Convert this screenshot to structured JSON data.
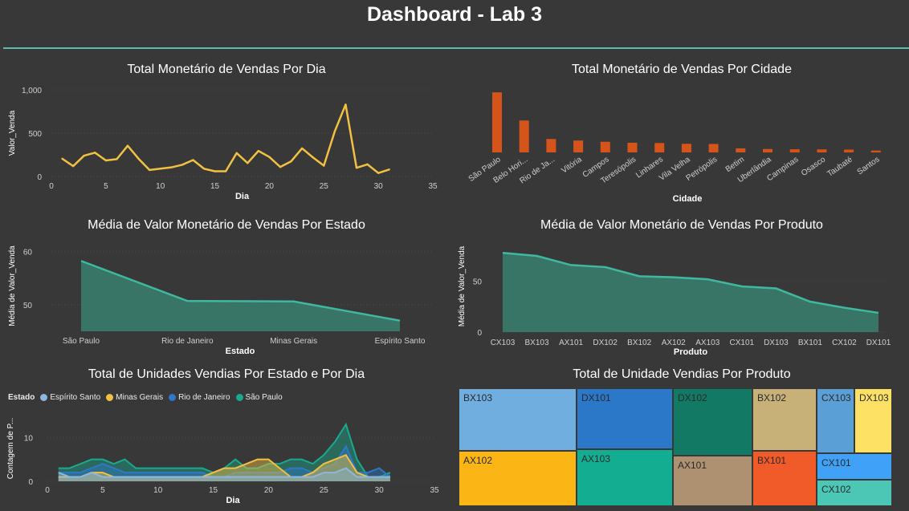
{
  "dashboard": {
    "title": "Dashboard - Lab 3"
  },
  "chart_data": [
    {
      "id": "daily",
      "type": "line",
      "title": "Total Monetário de Vendas Por Dia",
      "xlabel": "Dia",
      "ylabel": "Valor_Venda",
      "xlim": [
        0,
        35
      ],
      "ylim": [
        0,
        1000
      ],
      "xticks": [
        "0",
        "5",
        "10",
        "15",
        "20",
        "25",
        "30",
        "35"
      ],
      "yticks": [
        "0",
        "500",
        "1,000"
      ],
      "color": "#f2c043",
      "x": [
        1,
        2,
        3,
        4,
        5,
        6,
        7,
        8,
        9,
        10,
        11,
        12,
        13,
        14,
        15,
        16,
        17,
        18,
        19,
        20,
        21,
        22,
        23,
        24,
        25,
        26,
        27,
        28,
        29,
        30,
        31
      ],
      "values": [
        205,
        120,
        240,
        275,
        185,
        200,
        355,
        205,
        75,
        90,
        105,
        135,
        190,
        90,
        60,
        60,
        270,
        155,
        295,
        225,
        110,
        175,
        325,
        220,
        125,
        520,
        830,
        100,
        140,
        40,
        80
      ]
    },
    {
      "id": "city",
      "type": "bar",
      "title": "Total Monetário de Vendas Por Cidade",
      "xlabel": "Cidade",
      "ylabel": "",
      "color": "#d5541a",
      "categories": [
        "São Paulo",
        "Belo Hori...",
        "Rio de Ja...",
        "Vitória",
        "Campos",
        "Teresópolis",
        "Linhares",
        "Vila Velha",
        "Petrópolis",
        "Betim",
        "Uberlândia",
        "Campinas",
        "Osasco",
        "Taubaté",
        "Santos"
      ],
      "values": [
        960,
        510,
        215,
        190,
        170,
        155,
        150,
        138,
        135,
        65,
        55,
        50,
        48,
        45,
        30
      ],
      "ylim": [
        0,
        1000
      ]
    },
    {
      "id": "state_avg",
      "type": "area",
      "title": "Média de Valor Monetário de Vendas Por Estado",
      "xlabel": "Estado",
      "ylabel": "Média de Valor_Venda",
      "ylim": [
        45,
        62
      ],
      "yticks": [
        "50",
        "60"
      ],
      "color": "#40b8a0",
      "fill": "#387566",
      "categories": [
        "São Paulo",
        "Rio de Janeiro",
        "Minas Gerais",
        "Espírito Santo"
      ],
      "values": [
        58.2,
        50.7,
        50.6,
        47.0
      ]
    },
    {
      "id": "product_avg",
      "type": "area",
      "title": "Média de Valor Monetário de Vendas Por Produto",
      "xlabel": "Produto",
      "ylabel": "Média de Valor_Venda",
      "ylim": [
        0,
        90
      ],
      "yticks": [
        "0",
        "50"
      ],
      "color": "#40b8a0",
      "fill": "#387566",
      "categories": [
        "CX103",
        "BX103",
        "AX101",
        "DX102",
        "BX102",
        "AX102",
        "AX103",
        "CX101",
        "DX103",
        "BX101",
        "CX102",
        "DX101"
      ],
      "values": [
        78,
        75,
        66,
        64,
        55,
        54,
        52,
        45,
        43,
        30,
        24,
        19
      ]
    },
    {
      "id": "units_state_day",
      "type": "area",
      "title": "Total de Unidades Vendias Por Estado e Por Dia",
      "xlabel": "Dia",
      "ylabel": "Contagem de P...",
      "legend_title": "Estado",
      "legend_position": "top-left",
      "xlim": [
        0,
        35
      ],
      "ylim": [
        0,
        15
      ],
      "xticks": [
        "0",
        "5",
        "10",
        "15",
        "20",
        "25",
        "30",
        "35"
      ],
      "yticks": [
        "0",
        "10"
      ],
      "x": [
        1,
        2,
        3,
        4,
        5,
        6,
        7,
        8,
        9,
        10,
        11,
        12,
        13,
        14,
        15,
        16,
        17,
        18,
        19,
        20,
        21,
        22,
        23,
        24,
        25,
        26,
        27,
        28,
        29,
        30,
        31
      ],
      "series": [
        {
          "name": "Espírito Santo",
          "color": "#8fb7dd",
          "values": [
            2,
            1,
            1,
            2,
            1,
            1,
            1,
            1,
            1,
            1,
            1,
            1,
            1,
            1,
            1,
            1,
            1,
            1,
            1,
            1,
            1,
            1,
            1,
            1,
            2,
            2,
            3,
            1,
            1,
            1,
            1
          ]
        },
        {
          "name": "Minas Gerais",
          "color": "#f2c043",
          "values": [
            1,
            1,
            1,
            2,
            2,
            1,
            1,
            1,
            1,
            1,
            1,
            1,
            1,
            1,
            2,
            3,
            3,
            4,
            5,
            5,
            3,
            1,
            1,
            2,
            4,
            5,
            6,
            2,
            1,
            1,
            1
          ]
        },
        {
          "name": "Rio de Janeiro",
          "color": "#2f77c8",
          "values": [
            2,
            2,
            2,
            3,
            4,
            3,
            2,
            2,
            2,
            2,
            2,
            2,
            2,
            2,
            1,
            1,
            2,
            2,
            2,
            2,
            2,
            3,
            3,
            2,
            3,
            4,
            8,
            2,
            2,
            3,
            1
          ]
        },
        {
          "name": "São Paulo",
          "color": "#1aa98c",
          "values": [
            3,
            3,
            4,
            5,
            5,
            4,
            5,
            3,
            3,
            3,
            3,
            3,
            3,
            3,
            2,
            3,
            5,
            3,
            3,
            4,
            4,
            5,
            5,
            4,
            6,
            9,
            13,
            5,
            1,
            1,
            2
          ]
        }
      ]
    },
    {
      "id": "units_product",
      "type": "treemap",
      "title": "Total de Unidade Vendias Por Produto",
      "categories": [
        "BX103",
        "AX102",
        "DX101",
        "AX103",
        "DX102",
        "AX101",
        "BX102",
        "BX101",
        "CX103",
        "DX103",
        "CX101",
        "CX102"
      ],
      "colors": [
        "#71aee0",
        "#fbb615",
        "#2a78c7",
        "#13ae91",
        "#127a64",
        "#ad9171",
        "#c7b179",
        "#f15a29",
        "#5a9fd6",
        "#fde164",
        "#3fa1f7",
        "#4dc7b5"
      ]
    }
  ]
}
